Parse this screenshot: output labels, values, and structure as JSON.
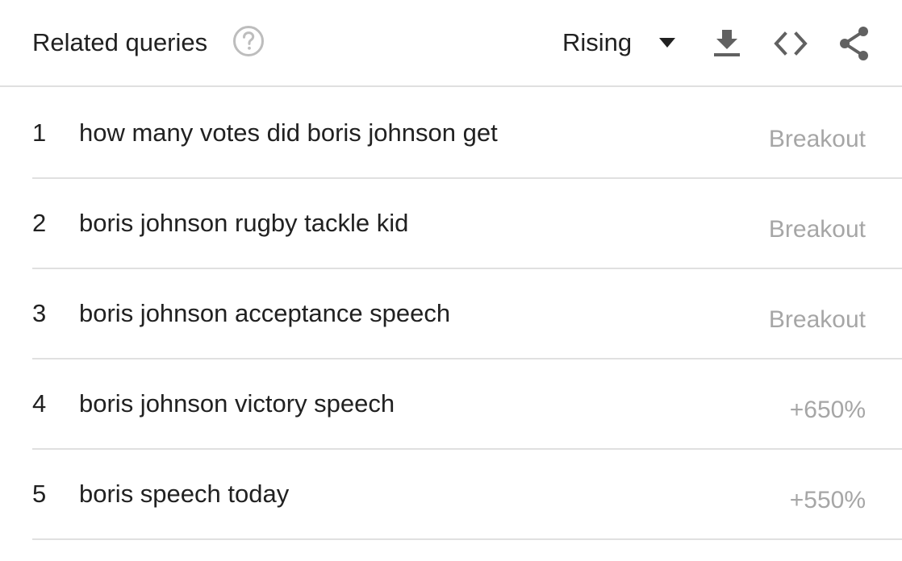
{
  "header": {
    "title": "Related queries",
    "help_icon": "help-circle-icon",
    "dropdown": {
      "selected": "Rising",
      "icon": "caret-down-icon"
    },
    "tools": [
      {
        "name": "download",
        "icon": "download-icon"
      },
      {
        "name": "embed",
        "icon": "code-icon"
      },
      {
        "name": "share",
        "icon": "share-icon"
      }
    ]
  },
  "queries": [
    {
      "rank": "1",
      "query": "how many votes did boris johnson get",
      "value": "Breakout"
    },
    {
      "rank": "2",
      "query": "boris johnson rugby tackle kid",
      "value": "Breakout"
    },
    {
      "rank": "3",
      "query": "boris johnson acceptance speech",
      "value": "Breakout"
    },
    {
      "rank": "4",
      "query": "boris johnson victory speech",
      "value": "+650%"
    },
    {
      "rank": "5",
      "query": "boris speech today",
      "value": "+550%"
    }
  ],
  "colors": {
    "text": "#212121",
    "muted_value": "#a6a6a6",
    "icon": "#616161",
    "help_icon": "#bdbdbd",
    "divider": "#e0e0e0"
  }
}
